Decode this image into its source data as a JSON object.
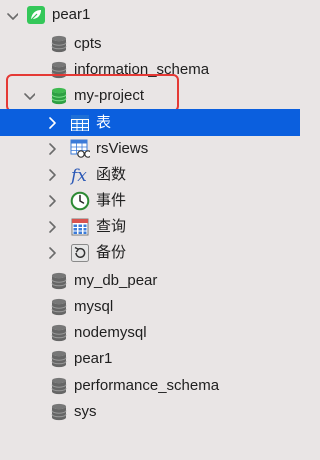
{
  "tree": {
    "connection": {
      "label": "pear1",
      "icon": "leaf-connection-icon"
    },
    "databases_top": [
      {
        "label": "cpts",
        "icon": "database-icon"
      },
      {
        "label": "information_schema",
        "icon": "database-icon"
      }
    ],
    "active_db": {
      "label": "my-project",
      "icon": "database-green-icon",
      "expanded": true
    },
    "children": [
      {
        "label": "表",
        "icon": "table-icon",
        "selected": true
      },
      {
        "label": "rsViews",
        "icon": "view-icon"
      },
      {
        "label": "函数",
        "icon": "function-icon"
      },
      {
        "label": "事件",
        "icon": "event-clock-icon"
      },
      {
        "label": "查询",
        "icon": "query-icon"
      },
      {
        "label": "备份",
        "icon": "backup-icon"
      }
    ],
    "databases_bottom": [
      {
        "label": "my_db_pear",
        "icon": "database-icon"
      },
      {
        "label": "mysql",
        "icon": "database-icon"
      },
      {
        "label": "nodemysql",
        "icon": "database-icon"
      },
      {
        "label": "pear1",
        "icon": "database-icon"
      },
      {
        "label": "performance_schema",
        "icon": "database-icon"
      },
      {
        "label": "sys",
        "icon": "database-icon"
      }
    ]
  },
  "colors": {
    "background": "#e9e5e5",
    "selection": "#0b5fde",
    "highlight_box": "#e53935",
    "db_gray": "#6e6e6e",
    "db_green": "#2ea043",
    "connection_green": "#34c759"
  }
}
